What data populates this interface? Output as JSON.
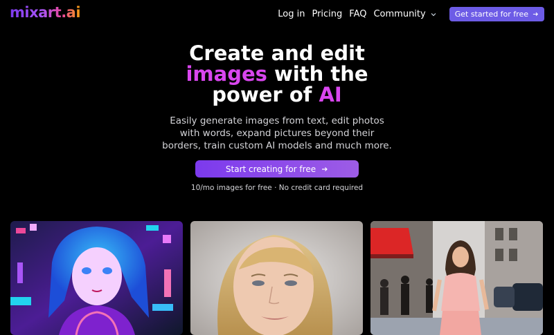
{
  "brand": {
    "logo_text": "mixart.ai"
  },
  "nav": {
    "login": "Log in",
    "pricing": "Pricing",
    "faq": "FAQ",
    "community": "Community",
    "cta": "Get started for free"
  },
  "hero": {
    "title_line1": "Create and edit",
    "title_accent1": "images",
    "title_line2_rest": " with the",
    "title_line3_start": "power of ",
    "title_accent2": "AI",
    "subtitle": "Easily generate images from text, edit photos with words, expand pictures beyond their borders, train custom AI models and much more.",
    "cta": "Start creating for free",
    "note": "10/mo images for free · No credit card required"
  },
  "gallery": {
    "items": [
      {
        "name": "anime-portrait"
      },
      {
        "name": "blonde-portrait"
      },
      {
        "name": "street-fashion"
      }
    ]
  },
  "colors": {
    "background": "#000000",
    "accent": "#d946ef",
    "button": "#6d5ce6"
  }
}
